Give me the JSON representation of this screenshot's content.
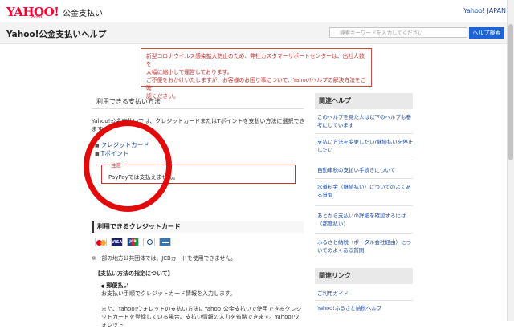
{
  "topbar": {
    "brand": "YAHOO!",
    "brand_sub": "JAPAN",
    "service": "公金支払い",
    "right_link": "Yahoo! JAPAN"
  },
  "header": {
    "title": "Yahoo!公金支払いヘルプ",
    "search_placeholder": "検索キーワードを入力してください",
    "search_button": "ヘルプ検索"
  },
  "notice": {
    "lines": [
      "新型コロナウイルス感染拡大防止のため、弊社カスタマーサポートセンターは、出社人数を",
      "大幅に縮小して運営しております。",
      "ご不便をおかけいたしますが、お客様のお困り事について、Yahoo!ヘルプの解決方法をご確",
      "認ください。"
    ]
  },
  "main": {
    "section_title": "利用できる支払い方法",
    "intro": "Yahoo!公金支払いでは、クレジットカードまたはTポイントを支払い方法に選択できます。",
    "pay_methods": [
      "クレジットカード",
      "Tポイント"
    ],
    "caution_label": "注意",
    "caution_text": "PayPayでは支払えません。",
    "cc_heading": "利用できるクレジットカード",
    "cards": [
      {
        "icon": "mastercard-icon",
        "label": ""
      },
      {
        "icon": "visa-icon",
        "label": "VISA"
      },
      {
        "icon": "jcb-icon",
        "label": "JCB"
      },
      {
        "icon": "diners-icon",
        "label": ""
      },
      {
        "icon": "amex-icon",
        "label": ""
      }
    ],
    "cc_note": "※一部の地方公共団体では、JCBカードを使用できません。",
    "spec_heading": "【支払い方法の指定について】",
    "spec_item": "郵便払い",
    "spec_desc": "お支払い手順でクレジットカード情報を入力します。",
    "spec_more": "また、Yahoo!ウォレットの支払い方法にYahoo!公金支払いで使用できるクレジットカードを登録している場合、支払い情報の入力を省略できます。Yahoo!ウォレット"
  },
  "sidebar": {
    "related_title": "関連ヘルプ",
    "related_links": [
      "このヘルプを見た人は以下のヘルプも参考にしています",
      "支払い方法を変更したい/継続払いを停止したい",
      "自動車税の支払い手続きについて",
      "水道料金（継続払い）についてのよくある質問",
      "あとから支払いの詳細を確認するには（都度払い）",
      "ふるさと納税（ポータル会社経由）についてのよくある質問"
    ],
    "links_title": "関連リンク",
    "links": [
      "ご利用ガイド",
      "Yahoo!ふるさと納税ヘルプ"
    ]
  },
  "colors": {
    "accent_red": "#e20b0b",
    "link_blue": "#1a4aa8",
    "button_blue": "#1f64d6"
  }
}
